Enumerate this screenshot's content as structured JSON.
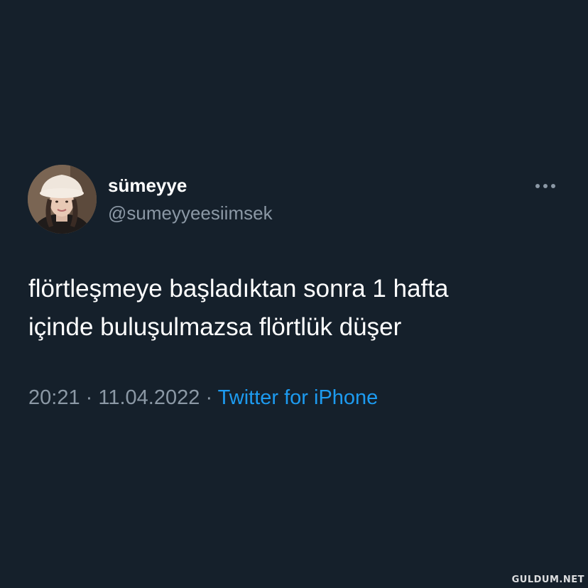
{
  "tweet": {
    "author": {
      "display_name": "sümeyye",
      "handle": "@sumeyyeesiimsek",
      "avatar_icon": "profile-photo"
    },
    "more_icon": "more-options-icon",
    "text_lines": [
      "flörtleşmeye başladıktan sonra 1 hafta",
      "içinde buluşulmazsa flörtlük düşer"
    ],
    "time": "20:21",
    "separator": "·",
    "date": "11.04.2022",
    "source": "Twitter for iPhone"
  },
  "watermark": "GULDUM.NET",
  "colors": {
    "background": "#15202b",
    "text": "#ffffff",
    "muted": "#8b98a5",
    "link": "#1d9bf0"
  }
}
